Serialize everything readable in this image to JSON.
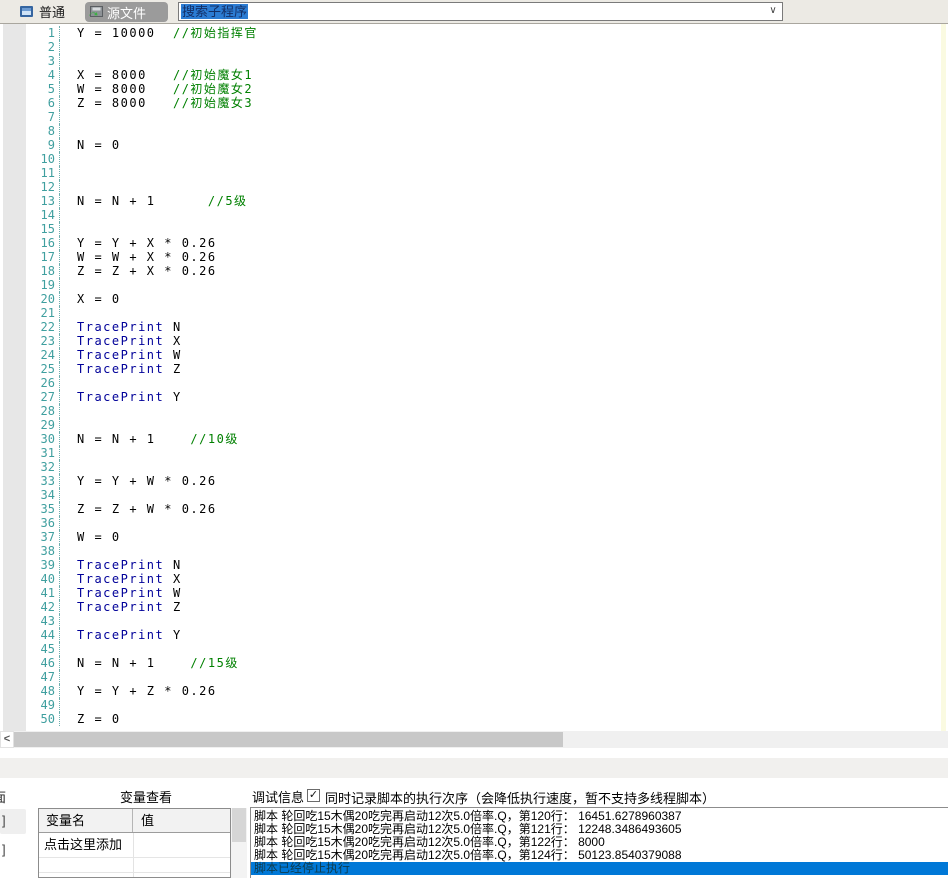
{
  "toolbar": {
    "normal_label": "普通",
    "source_label": "源文件",
    "search_value": "搜索子程序"
  },
  "icons": {
    "chevron_down": "∨",
    "scroll_left": "<",
    "check": "✓"
  },
  "editor": {
    "lines": [
      {
        "num": 1,
        "segs": [
          {
            "t": "code",
            "s": "Y = 10000  "
          },
          {
            "t": "comment",
            "s": "//初始指挥官"
          }
        ]
      },
      {
        "num": 2
      },
      {
        "num": 3
      },
      {
        "num": 4,
        "segs": [
          {
            "t": "code",
            "s": "X = 8000   "
          },
          {
            "t": "comment",
            "s": "//初始魔女1"
          }
        ]
      },
      {
        "num": 5,
        "segs": [
          {
            "t": "code",
            "s": "W = 8000   "
          },
          {
            "t": "comment",
            "s": "//初始魔女2"
          }
        ]
      },
      {
        "num": 6,
        "segs": [
          {
            "t": "code",
            "s": "Z = 8000   "
          },
          {
            "t": "comment",
            "s": "//初始魔女3"
          }
        ]
      },
      {
        "num": 7
      },
      {
        "num": 8
      },
      {
        "num": 9,
        "segs": [
          {
            "t": "code",
            "s": "N = 0"
          }
        ]
      },
      {
        "num": 10
      },
      {
        "num": 11
      },
      {
        "num": 12
      },
      {
        "num": 13,
        "segs": [
          {
            "t": "code",
            "s": "N = N + 1      "
          },
          {
            "t": "comment",
            "s": "//5级"
          }
        ]
      },
      {
        "num": 14
      },
      {
        "num": 15
      },
      {
        "num": 16,
        "segs": [
          {
            "t": "code",
            "s": "Y = Y + X * 0.26"
          }
        ]
      },
      {
        "num": 17,
        "segs": [
          {
            "t": "code",
            "s": "W = W + X * 0.26"
          }
        ]
      },
      {
        "num": 18,
        "segs": [
          {
            "t": "code",
            "s": "Z = Z + X * 0.26"
          }
        ]
      },
      {
        "num": 19
      },
      {
        "num": 20,
        "segs": [
          {
            "t": "code",
            "s": "X = 0"
          }
        ]
      },
      {
        "num": 21
      },
      {
        "num": 22,
        "segs": [
          {
            "t": "kw",
            "s": "TracePrint"
          },
          {
            "t": "code",
            "s": " N"
          }
        ]
      },
      {
        "num": 23,
        "segs": [
          {
            "t": "kw",
            "s": "TracePrint"
          },
          {
            "t": "code",
            "s": " X"
          }
        ]
      },
      {
        "num": 24,
        "segs": [
          {
            "t": "kw",
            "s": "TracePrint"
          },
          {
            "t": "code",
            "s": " W"
          }
        ]
      },
      {
        "num": 25,
        "segs": [
          {
            "t": "kw",
            "s": "TracePrint"
          },
          {
            "t": "code",
            "s": " Z"
          }
        ]
      },
      {
        "num": 26
      },
      {
        "num": 27,
        "segs": [
          {
            "t": "kw",
            "s": "TracePrint"
          },
          {
            "t": "code",
            "s": " Y"
          }
        ]
      },
      {
        "num": 28
      },
      {
        "num": 29
      },
      {
        "num": 30,
        "segs": [
          {
            "t": "code",
            "s": "N = N + 1    "
          },
          {
            "t": "comment",
            "s": "//10级"
          }
        ]
      },
      {
        "num": 31
      },
      {
        "num": 32
      },
      {
        "num": 33,
        "segs": [
          {
            "t": "code",
            "s": "Y = Y + W * 0.26"
          }
        ]
      },
      {
        "num": 34
      },
      {
        "num": 35,
        "segs": [
          {
            "t": "code",
            "s": "Z = Z + W * 0.26"
          }
        ]
      },
      {
        "num": 36
      },
      {
        "num": 37,
        "segs": [
          {
            "t": "code",
            "s": "W = 0"
          }
        ]
      },
      {
        "num": 38
      },
      {
        "num": 39,
        "segs": [
          {
            "t": "kw",
            "s": "TracePrint"
          },
          {
            "t": "code",
            "s": " N"
          }
        ]
      },
      {
        "num": 40,
        "segs": [
          {
            "t": "kw",
            "s": "TracePrint"
          },
          {
            "t": "code",
            "s": " X"
          }
        ]
      },
      {
        "num": 41,
        "segs": [
          {
            "t": "kw",
            "s": "TracePrint"
          },
          {
            "t": "code",
            "s": " W"
          }
        ]
      },
      {
        "num": 42,
        "segs": [
          {
            "t": "kw",
            "s": "TracePrint"
          },
          {
            "t": "code",
            "s": " Z"
          }
        ]
      },
      {
        "num": 43
      },
      {
        "num": 44,
        "segs": [
          {
            "t": "kw",
            "s": "TracePrint"
          },
          {
            "t": "code",
            "s": " Y"
          }
        ]
      },
      {
        "num": 45
      },
      {
        "num": 46,
        "segs": [
          {
            "t": "code",
            "s": "N = N + 1    "
          },
          {
            "t": "comment",
            "s": "//15级"
          }
        ]
      },
      {
        "num": 47
      },
      {
        "num": 48,
        "segs": [
          {
            "t": "code",
            "s": "Y = Y + Z * 0.26"
          }
        ]
      },
      {
        "num": 49
      },
      {
        "num": 50,
        "segs": [
          {
            "t": "code",
            "s": "Z = 0"
          }
        ]
      }
    ]
  },
  "bottom": {
    "fragments": [
      "面",
      "]",
      "]"
    ],
    "variables": {
      "title": "变量查看",
      "columns": [
        "变量名",
        "值"
      ],
      "rows": [
        [
          "点击这里添加",
          ""
        ]
      ]
    },
    "debug": {
      "title": "调试信息",
      "checkbox_checked": true,
      "checkbox_label": "同时记录脚本的执行次序（会降低执行速度，暂不支持多线程脚本）",
      "lines": [
        "脚本 轮回吃15木偶20吃完再启动12次5.0倍率.Q，第120行： 16451.6278960387",
        "脚本 轮回吃15木偶20吃完再启动12次5.0倍率.Q，第121行： 12248.3486493605",
        "脚本 轮回吃15木偶20吃完再启动12次5.0倍率.Q，第122行： 8000",
        "脚本 轮回吃15木偶20吃完再启动12次5.0倍率.Q，第124行： 50123.8540379088"
      ],
      "stopped_line": "脚本已经停止执行"
    }
  },
  "colors": {
    "selection_blue": "#0078D7",
    "comment_green": "#008000",
    "keyword_blue": "#000099",
    "line_number_teal": "#3F9F9F",
    "toolbar_gray": "#ECEAE4"
  }
}
